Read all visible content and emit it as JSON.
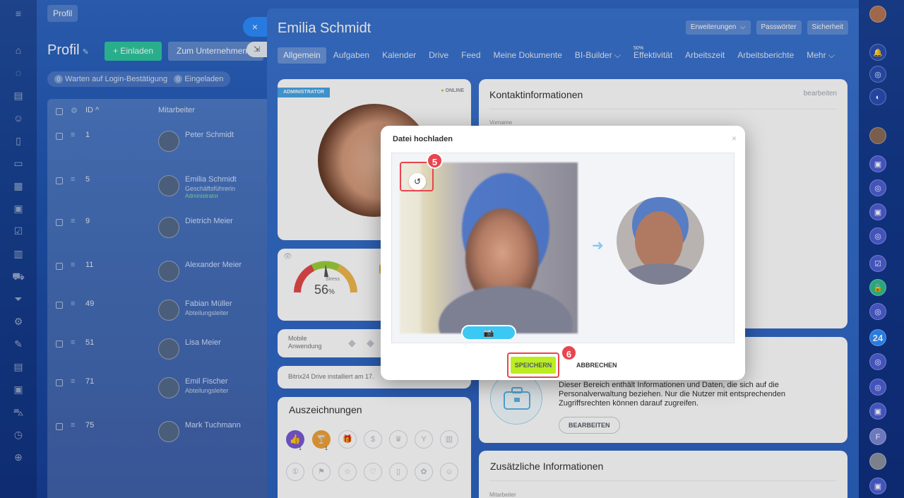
{
  "top": {
    "profile_button": "Profil"
  },
  "page": {
    "title": "Profil",
    "invite_button": "Einladen",
    "company_button": "Zum Unternehmen h",
    "filter_waiting_count": "0",
    "filter_waiting_label": "Warten auf Login-Bestätigung",
    "filter_invited_count": "0",
    "filter_invited_label": "Eingeladen",
    "columns": {
      "id": "ID ^",
      "employee": "Mitarbeiter"
    },
    "rows": [
      {
        "id": "1",
        "name": "Peter Schmidt",
        "position": "",
        "role": ""
      },
      {
        "id": "5",
        "name": "Emilia Schmidt",
        "position": "Geschäftsführerin",
        "role": "Administrator"
      },
      {
        "id": "9",
        "name": "Dietrich Meier",
        "position": "",
        "role": ""
      },
      {
        "id": "11",
        "name": "Alexander Meier",
        "position": "",
        "role": ""
      },
      {
        "id": "49",
        "name": "Fabian Müller",
        "position": "Abteilungsleiter",
        "role": ""
      },
      {
        "id": "51",
        "name": "Lisa Meier",
        "position": "",
        "role": ""
      },
      {
        "id": "71",
        "name": "Emil Fischer",
        "position": "Abteilungsleiter",
        "role": ""
      },
      {
        "id": "75",
        "name": "Mark Tuchmann",
        "position": "",
        "role": ""
      }
    ]
  },
  "slider": {
    "title": "Emilia Schmidt",
    "actions": [
      "Erweiterungen",
      "Passwörter",
      "Sicherheit"
    ],
    "tabs": [
      {
        "label": "Allgemein",
        "sup": ""
      },
      {
        "label": "Aufgaben",
        "sup": ""
      },
      {
        "label": "Kalender",
        "sup": ""
      },
      {
        "label": "Drive",
        "sup": ""
      },
      {
        "label": "Feed",
        "sup": ""
      },
      {
        "label": "Meine Dokumente",
        "sup": ""
      },
      {
        "label": "BI-Builder ⌵",
        "sup": ""
      },
      {
        "label": "Effektivität",
        "sup": "50%"
      },
      {
        "label": "Arbeitszeit",
        "sup": ""
      },
      {
        "label": "Arbeitsberichte",
        "sup": ""
      },
      {
        "label": "Mehr ⌵",
        "sup": ""
      }
    ],
    "badge_admin": "ADMINISTRATOR",
    "status_online": "ONLINE",
    "stress_label": "Stress",
    "stress_value": "56",
    "stress_unit": "%",
    "mobile_app": "Mobile Anwendung",
    "drive_installed": "Bitrix24 Drive installiert am 17.",
    "awards_title": "Auszeichnungen",
    "contact_title": "Kontaktinformationen",
    "contact_edit": "bearbeiten",
    "contact_field_firstname": "Vorname",
    "hr_text": "Dieser Bereich enthält Informationen und Daten, die sich auf die Personalverwaltung beziehen. Nur die Nutzer mit entsprechenden Zugriffsrechten können darauf zugreifen.",
    "hr_button": "BEARBEITEN",
    "additional_title": "Zusätzliche Informationen",
    "additional_field": "Mitarbeiter",
    "award_counts": [
      "1",
      "1"
    ]
  },
  "modal": {
    "title": "Datei hochladen",
    "close": "×",
    "save": "SPEICHERN",
    "cancel": "ABBRECHEN",
    "step_rotate": "5",
    "step_save": "6"
  },
  "rightbar": {
    "counter": "24"
  },
  "colors": {
    "accent": "#2fc6a0",
    "save": "#bbed21",
    "highlight": "#e8454e",
    "link": "#3bc8f5"
  }
}
